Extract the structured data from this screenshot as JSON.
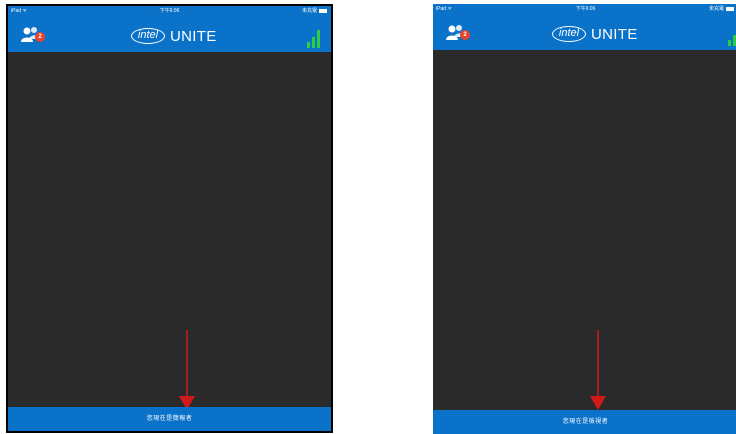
{
  "screens": [
    {
      "status_bar": {
        "left": "iPad ᯤ",
        "time": "下午6:06",
        "right": "未充電"
      },
      "header": {
        "participants_badge": "2",
        "logo_text": "intel",
        "product_name": "UNITE"
      },
      "footer": {
        "text": "您現在是簡報者"
      }
    },
    {
      "status_bar": {
        "left": "iPad ᯤ",
        "time": "下午6:06",
        "right": "未充電"
      },
      "header": {
        "participants_badge": "2",
        "logo_text": "intel",
        "product_name": "UNITE"
      },
      "footer": {
        "text": "您現在是檢視者"
      }
    }
  ],
  "colors": {
    "header_blue": "#0a72c9",
    "screen_background": "#2a2a2a",
    "badge": "#e8442c",
    "signal_green": "#2ecc40",
    "annotation_arrow": "#d11a1a"
  },
  "icons": {
    "participants": "participants-icon",
    "signal": "signal-strength-icon",
    "battery": "battery-icon",
    "annotation": "red-down-arrow-icon"
  }
}
